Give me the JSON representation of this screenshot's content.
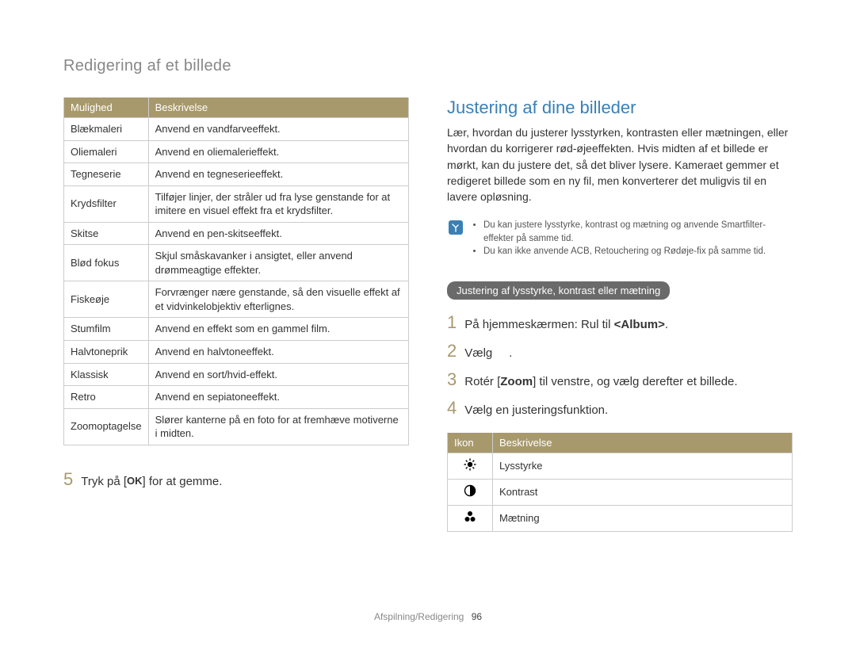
{
  "page_title": "Redigering af et billede",
  "options_table": {
    "header_option": "Mulighed",
    "header_desc": "Beskrivelse",
    "rows": [
      {
        "option": "Blækmaleri",
        "desc": "Anvend en vandfarveeffekt."
      },
      {
        "option": "Oliemaleri",
        "desc": "Anvend en oliemalerieffekt."
      },
      {
        "option": "Tegneserie",
        "desc": "Anvend en tegneserieeffekt."
      },
      {
        "option": "Krydsfilter",
        "desc": "Tilføjer linjer, der stråler ud fra lyse genstande for at imitere en visuel effekt fra et krydsfilter."
      },
      {
        "option": "Skitse",
        "desc": "Anvend en pen-skitseeffekt."
      },
      {
        "option": "Blød fokus",
        "desc": "Skjul småskavanker i ansigtet, eller anvend drømmeagtige effekter."
      },
      {
        "option": "Fiskeøje",
        "desc": "Forvrænger nære genstande, så den visuelle effekt af et vidvinkelobjektiv efterlignes."
      },
      {
        "option": "Stumfilm",
        "desc": "Anvend en effekt som en gammel film."
      },
      {
        "option": "Halvtoneprik",
        "desc": "Anvend en halvtoneeffekt."
      },
      {
        "option": "Klassisk",
        "desc": "Anvend en sort/hvid-effekt."
      },
      {
        "option": "Retro",
        "desc": "Anvend en sepiatoneeffekt."
      },
      {
        "option": "Zoomoptagelse",
        "desc": "Slører kanterne på en foto for at fremhæve motiverne i midten."
      }
    ]
  },
  "step5": {
    "num": "5",
    "text_before": "Tryk på [",
    "glyph": "OK",
    "text_after": "] for at gemme."
  },
  "right": {
    "heading": "Justering af dine billeder",
    "intro": "Lær, hvordan du justerer lysstyrken, kontrasten eller mætningen, eller hvordan du korrigerer rød-øjeeffekten. Hvis midten af et billede er mørkt, kan du justere det, så det bliver lysere. Kameraet gemmer et redigeret billede som en ny fil, men konverterer det muligvis til en lavere opløsning.",
    "notes": [
      "Du kan justere lysstyrke, kontrast og mætning og anvende Smartfilter-effekter på samme tid.",
      "Du kan ikke anvende ACB, Retouchering og Rødøje-fix på samme tid."
    ],
    "subheading": "Justering af lysstyrke, kontrast eller mætning",
    "steps": {
      "s1_num": "1",
      "s1_text_a": "På hjemmeskærmen: Rul til ",
      "s1_text_b": "<Album>",
      "s1_text_c": ".",
      "s2_num": "2",
      "s2_text_a": "Vælg",
      "s2_text_b": ".",
      "s3_num": "3",
      "s3_text_a": "Rotér [",
      "s3_text_b": "Zoom",
      "s3_text_c": "] til venstre, og vælg derefter et billede.",
      "s4_num": "4",
      "s4_text": "Vælg en justeringsfunktion."
    },
    "icon_table": {
      "header_icon": "Ikon",
      "header_desc": "Beskrivelse",
      "rows": [
        {
          "icon": "brightness",
          "desc": "Lysstyrke"
        },
        {
          "icon": "contrast",
          "desc": "Kontrast"
        },
        {
          "icon": "saturation",
          "desc": "Mætning"
        }
      ]
    }
  },
  "footer": {
    "section": "Afspilning/Redigering",
    "page": "96"
  },
  "icons": {
    "brightness": "☼",
    "contrast": "◐",
    "saturation": "⠿"
  }
}
